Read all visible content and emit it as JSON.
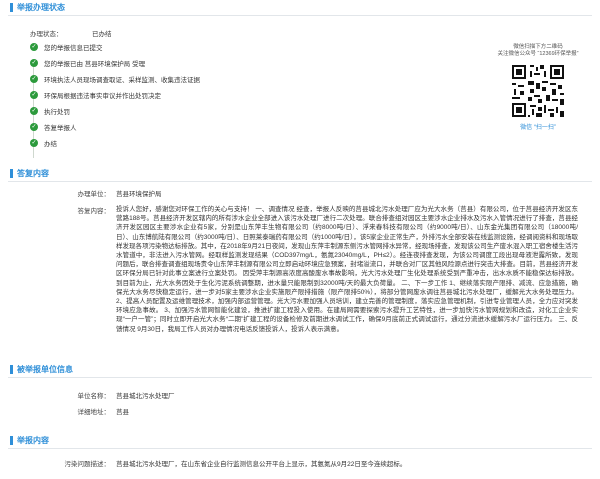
{
  "colors": {
    "accent": "#2f8fd8",
    "done": "#2c9a3c",
    "text": "#333333"
  },
  "sections": {
    "status": "举报办理状态",
    "reply": "答复内容",
    "basic": "被举报单位信息",
    "report": "举报内容"
  },
  "status": {
    "state_label": "办理状态：",
    "state_value": "已办结",
    "steps": [
      "您的举报信息已提交",
      "您的举报已由 莒县环境保护局 受理",
      "环境执法人员现场调查取证、采样监测、收集违法证据",
      "环保局根据违法事实审议并作出处罚决定",
      "执行处罚",
      "答复举报人",
      "办结"
    ]
  },
  "qr": {
    "line1": "微信扫描下方二维码",
    "line2": "关注微信公众号 “12369环保举报”",
    "caption": "微信 “扫一扫”"
  },
  "reply": {
    "unit_label": "办理单位：",
    "unit_value": "莒县环境保护局",
    "content_label": "答复内容：",
    "content_text": "投诉人您好，感谢您对环保工作的关心与支持！ 一、调查情况 经查，举报人反映的莒县城北污水处理厂应为光大水务（莒县）有限公司，位于莒县经济开发区东营路188号。莒县经济开发区辖内的所有涉水企业全部进入该污水处理厂进行二次处理。联合排查组对园区主要涉水企业排水及污水入管情况进行了排查，莒县经济开发区园区主要涉水企业有5家，分别是山东萍丰生物有限公司（约8000吨/日）、浮来春科技有限公司（约9000吨/日）、山东金光集团有限公司（18000吨/日）、山东博航陆有限公司（约3000吨/日）、日照莱泰瑞药有限公司（约1000吨/日），该5家企业正常生产，外排污水全部安装在线监测设施，经调阅资料和现场取样发现各项污染物达标排放。其中，在2018年9月21日夜间，发现山东萍丰制源东侧污水管网排水异常，经现场排查，发现该公司生产废水混入职工宿舍楼生活污水管道中，非法进入污水管网。经取样监测发现结果（COD397mg/L，氨氮23040mg/L，PH≤2）。经连夜排查发现，为该公司调度工段出现母液泄露所致，发现问题后，联合排查调查组现场责令山东萍丰制源有限公司立即启动环境应急预案，封堵溢流口，并联合对厂区其他风险源点进行突击大排查。目前，莒县经济开发区环保分局已针对此事立案进行立案处罚。 因受萍丰制源高浓度高酸废水事故影响，光大污水处理厂生化处理系统受到严重冲击，出水水质不能稳保达标排放。到目前为止，光大水务因处于生化污泥系统调整期，进水量只能限制到32000吨/天的最大负荷量。 二、下一步工作 1、继续落实限产限排、减流、应急措施，确保光大水务尽快稳定运行，进一步对5家主要涉水企业实施限产限排措施（限产限排50%），将部分管网废水调往莒县城北污水处理厂，缓解光大水务处理压力。 2、提高人员配置及运维管理技术，加强内部运营管理。光大污水要加强人员培训，建立完善的管理制度，落实应急管理机制，引进专业管理人员，全力应对突发环境应急事故。 3、加强污水管网智能化建设，推进扩建工程投入使用。在建局网需要探索污水提升工艺特性，进一步加快污水管网规划和改造，对化工企业实现“一户一管”；同时立即开启光大水务“二期”扩建工程的设备检修及前期进水调试工作，确保9月底前正式调试运行，通过分流进水缓解污水厂运行压力。 三、反馈情况 9月30日，我局工作人员对办理情况电话反馈投诉人，投诉人表示满意。"
  },
  "basic": {
    "name_label": "单位名称：",
    "name_value": "莒县城北污水处理厂",
    "addr_label": "详细地址：",
    "addr_value": "莒县"
  },
  "report": {
    "problem_label": "污染问题描述：",
    "problem_value": "莒县城北污水处理厂，在山东省企业自行监测信息公开平台上显示，其氨氮从9月22日至今连续超标。"
  }
}
